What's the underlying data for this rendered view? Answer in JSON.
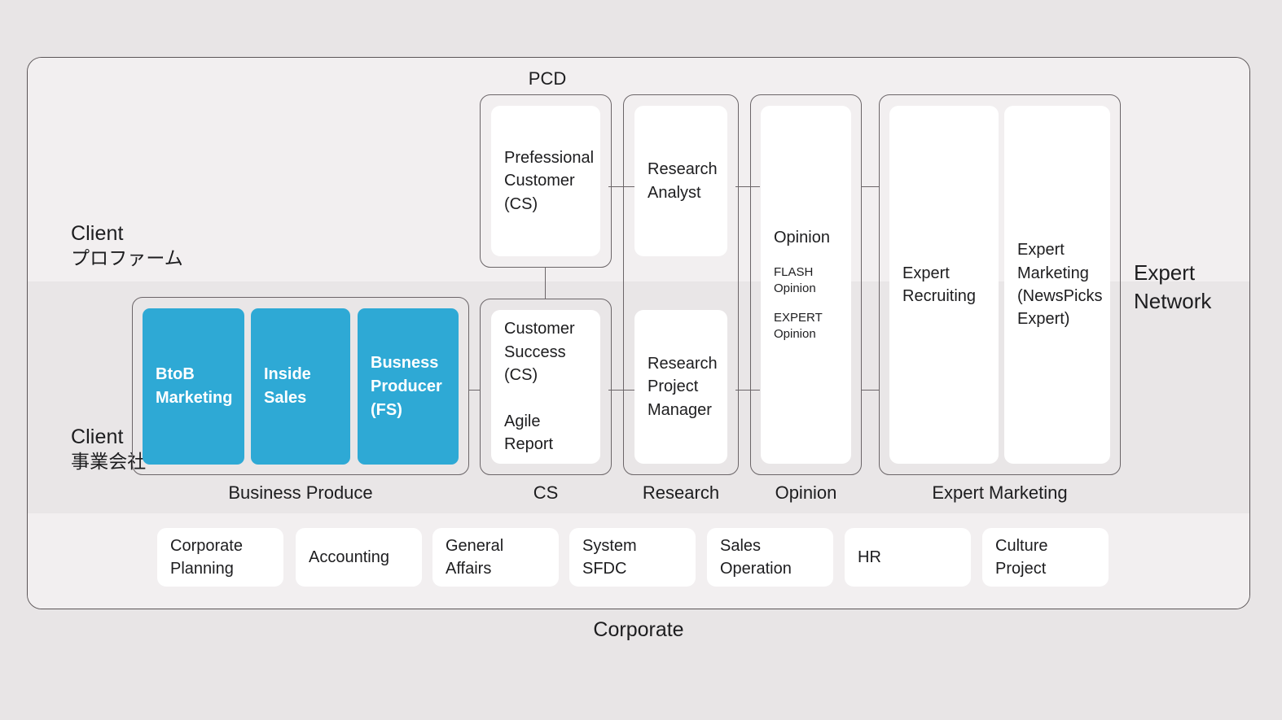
{
  "diagram": {
    "top_caption": "PCD",
    "bottom_caption": "Corporate",
    "side_label": "Expert\nNetwork",
    "side_label_line1": "Expert",
    "side_label_line2": "Network"
  },
  "row_labels": [
    {
      "title": "Client",
      "subtitle": "プロファーム"
    },
    {
      "title": "Client",
      "subtitle": "事業会社"
    }
  ],
  "columns": [
    {
      "caption": "Business Produce",
      "cards": [
        {
          "label": "BtoB\nMarketing",
          "style": "blue"
        },
        {
          "label": "Inside\nSales",
          "style": "blue"
        },
        {
          "label": "Busness\nProducer\n(FS)",
          "style": "blue"
        }
      ]
    },
    {
      "caption": "CS",
      "cards": [
        {
          "label": "Prefessional\nCustomer\n(CS)",
          "style": "white"
        },
        {
          "label": "Customer\nSuccess\n(CS)\n\nAgile\nReport",
          "style": "white"
        }
      ]
    },
    {
      "caption": "Research",
      "cards": [
        {
          "label": "Research\nAnalyst",
          "style": "white"
        },
        {
          "label": "Research\nProject\nManager",
          "style": "white"
        }
      ]
    },
    {
      "caption": "Opinion",
      "cards": [
        {
          "label": "Opinion",
          "style": "white"
        }
      ],
      "opinion_main": "Opinion",
      "opinion_sub_1": "FLASH\nOpinion",
      "opinion_sub_2": "EXPERT\nOpinion"
    },
    {
      "caption": "Expert Marketing",
      "cards": [
        {
          "label": "Expert\nRecruiting",
          "style": "white"
        },
        {
          "label": "Expert\nMarketing\n(NewsPicks\nExpert)",
          "style": "white"
        }
      ]
    }
  ],
  "corporate": {
    "cards": [
      {
        "label": "Corporate\nPlanning"
      },
      {
        "label": "Accounting"
      },
      {
        "label": "General\nAffairs"
      },
      {
        "label": "System\nSFDC"
      },
      {
        "label": "Sales\nOperation"
      },
      {
        "label": "HR"
      },
      {
        "label": "Culture\nProject"
      }
    ]
  },
  "colors": {
    "accent_blue": "#2ea9d5",
    "band_light": "#f2eff0",
    "band_dark": "#e9e6e7",
    "page_bg": "#e8e5e6",
    "stroke": "#6b6568",
    "card_white": "#ffffff",
    "text": "#1d1d1f"
  }
}
